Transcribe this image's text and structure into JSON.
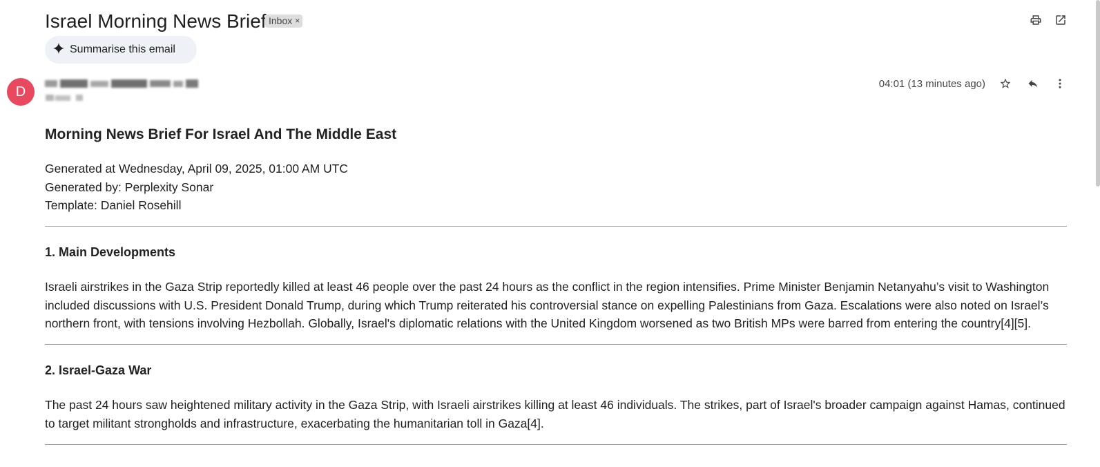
{
  "subject": "Israel Morning News Brief",
  "labels": {
    "inbox": "Inbox",
    "remove": "×"
  },
  "toolbar": {
    "print_icon": "print-icon",
    "open_new_window_icon": "open-in-new-icon"
  },
  "summarise": {
    "icon": "sparkle-icon",
    "label": "Summarise this email"
  },
  "sender": {
    "avatar_letter": "D",
    "avatar_color": "#e8495f"
  },
  "timestamp": "04:01 (13 minutes ago)",
  "actions": {
    "star_icon": "star-icon",
    "reply_icon": "reply-icon",
    "more_icon": "more-vert-icon"
  },
  "body": {
    "title": "Morning News Brief For Israel And The Middle East",
    "meta": [
      "Generated at Wednesday, April 09, 2025, 01:00 AM UTC",
      "Generated by: Perplexity Sonar",
      "Template: Daniel Rosehill"
    ],
    "sections": [
      {
        "heading": "1. Main Developments",
        "text": "Israeli airstrikes in the Gaza Strip reportedly killed at least 46 people over the past 24 hours as the conflict in the region intensifies. Prime Minister Benjamin Netanyahu’s visit to Washington included discussions with U.S. President Donald Trump, during which Trump reiterated his controversial stance on expelling Palestinians from Gaza. Escalations were also noted on Israel’s northern front, with tensions involving Hezbollah. Globally, Israel's diplomatic relations with the United Kingdom worsened as two British MPs were barred from entering the country[4][5]."
      },
      {
        "heading": "2. Israel-Gaza War",
        "text": "The past 24 hours saw heightened military activity in the Gaza Strip, with Israeli airstrikes killing at least 46 individuals. The strikes, part of Israel's broader campaign against Hamas, continued to target militant strongholds and infrastructure, exacerbating the humanitarian toll in Gaza[4]."
      }
    ]
  },
  "colors": {
    "accent_chip": "#eef1f6",
    "label_chip": "#dddddd",
    "text": "#1f1f1f",
    "muted": "#444746"
  }
}
